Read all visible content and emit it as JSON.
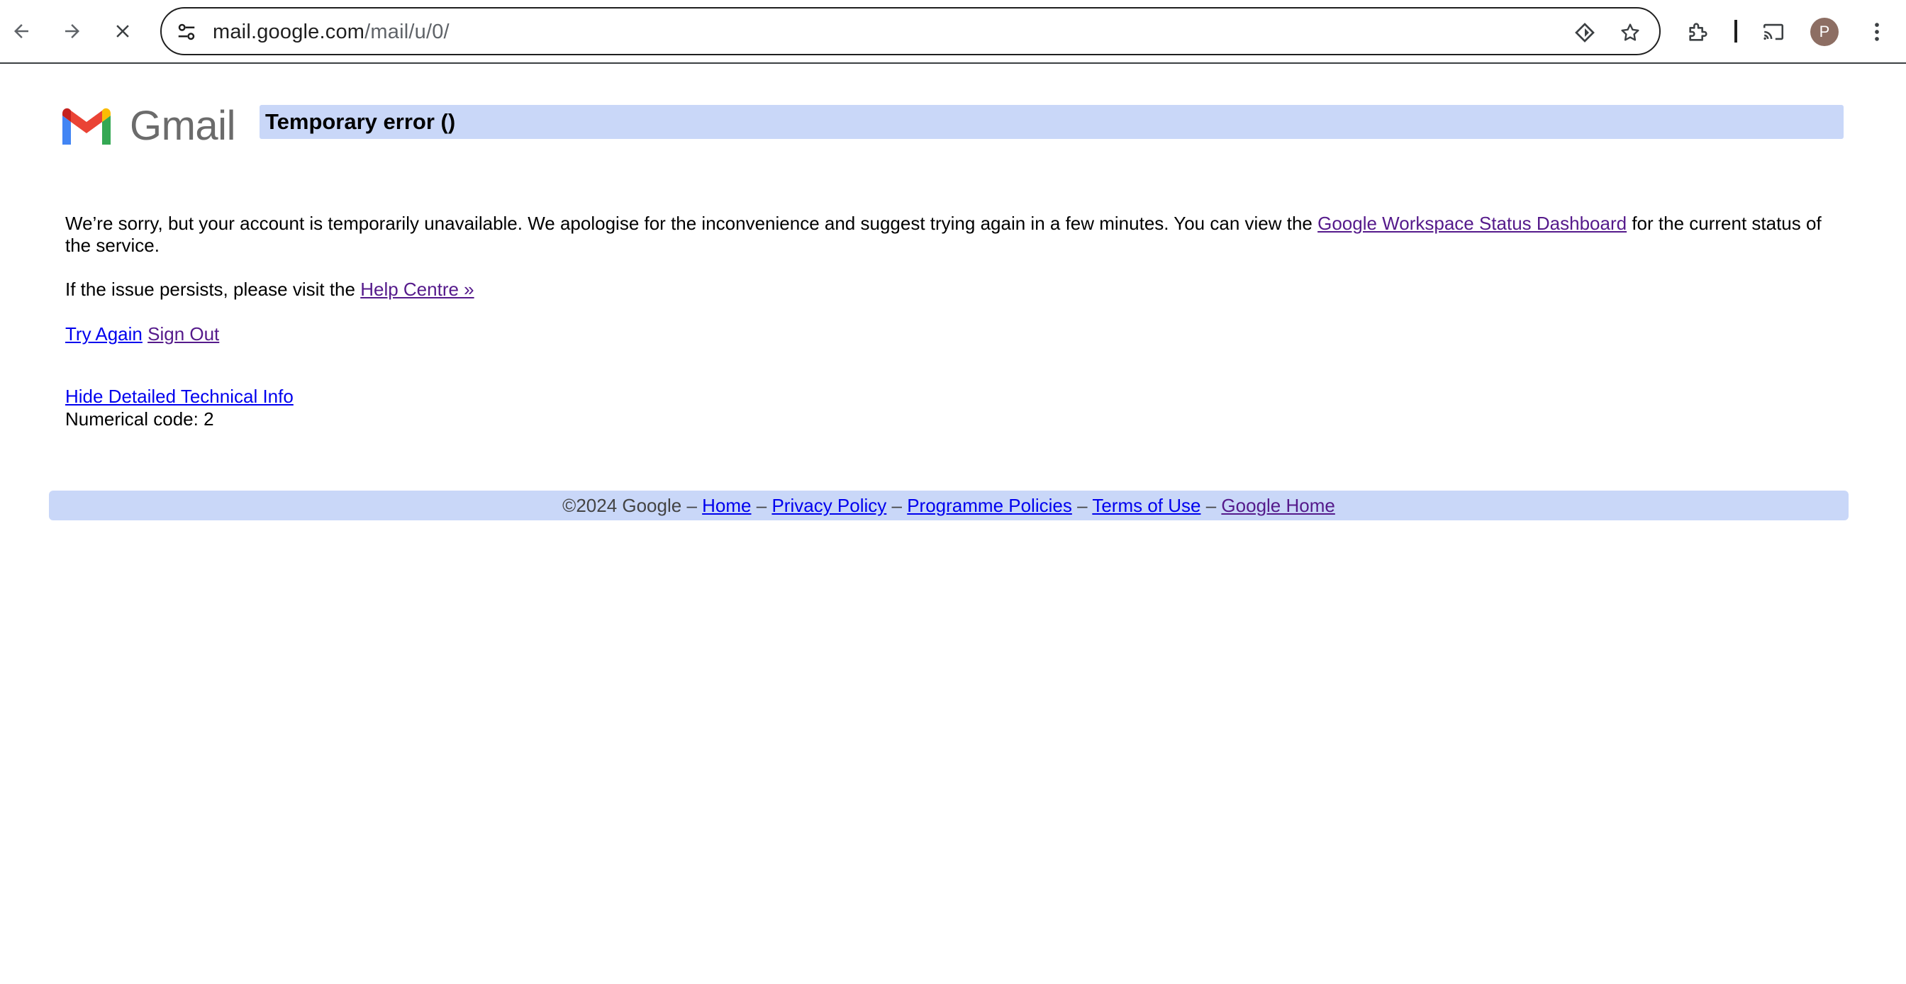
{
  "browser": {
    "url_host": "mail.google.com",
    "url_path": "/mail/u/0/",
    "profile_initial": "P",
    "icons": {
      "back": "arrow-back-icon",
      "forward": "arrow-forward-icon",
      "stop": "close-icon",
      "site_info": "tune-icon",
      "lens": "google-lens-icon",
      "bookmark": "star-outline-icon",
      "extensions": "puzzle-icon",
      "cast": "cast-icon",
      "menu": "more-vert-icon"
    }
  },
  "page": {
    "logo_text": "Gmail",
    "title": "Temporary error ()",
    "message": {
      "part1": "We’re sorry, but your account is temporarily unavailable. We apologise for the inconvenience and suggest trying again in a few minutes. You can view the ",
      "status_link": "Google Workspace Status Dashboard",
      "part2": " for the current status of the service."
    },
    "help": {
      "text": "If the issue persists, please visit the ",
      "link": "Help Centre »"
    },
    "actions": {
      "try_again": "Try Again",
      "sign_out": "Sign Out"
    },
    "tech": {
      "toggle": "Hide Detailed Technical Info",
      "code": "Numerical code: 2"
    }
  },
  "footer": {
    "copyright": "©2024 Google",
    "separator": "–",
    "home": "Home",
    "privacy": "Privacy Policy",
    "programme": "Programme Policies",
    "terms": "Terms of Use",
    "google_home": "Google Home"
  },
  "colors": {
    "banner_bg": "#c9d7f8",
    "link": "#0000ee",
    "visited_link": "#551a8b",
    "avatar_bg": "#8d6e63"
  }
}
